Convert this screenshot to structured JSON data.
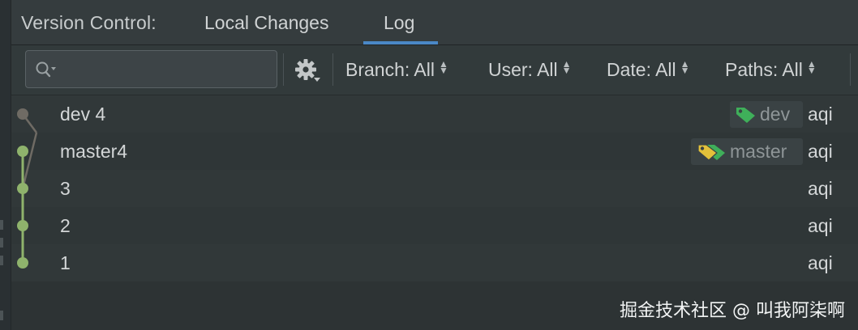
{
  "tabbar": {
    "prefix": "Version Control:",
    "tabs": [
      {
        "label": "Local Changes"
      },
      {
        "label": "Log",
        "active": true
      }
    ]
  },
  "toolbar": {
    "search": {
      "value": "",
      "placeholder": ""
    },
    "settings_icon": "gear-icon",
    "filters": [
      {
        "label": "Branch: All"
      },
      {
        "label": "User: All"
      },
      {
        "label": "Date: All"
      },
      {
        "label": "Paths: All"
      }
    ]
  },
  "commits": [
    {
      "message": "dev 4",
      "tag": "dev",
      "author": "aqi"
    },
    {
      "message": "master4",
      "tag": "master",
      "author": "aqi"
    },
    {
      "message": "3",
      "author": "aqi"
    },
    {
      "message": "2",
      "author": "aqi"
    },
    {
      "message": "1",
      "author": "aqi"
    }
  ],
  "colors": {
    "graph_dev": "#6f6b64",
    "graph_master": "#8fb36c",
    "tag_dev": "#3faf5a",
    "tag_master": "#e3c13a",
    "accent": "#4a88c7"
  },
  "watermark": "掘金技术社区 @ 叫我阿柒啊"
}
